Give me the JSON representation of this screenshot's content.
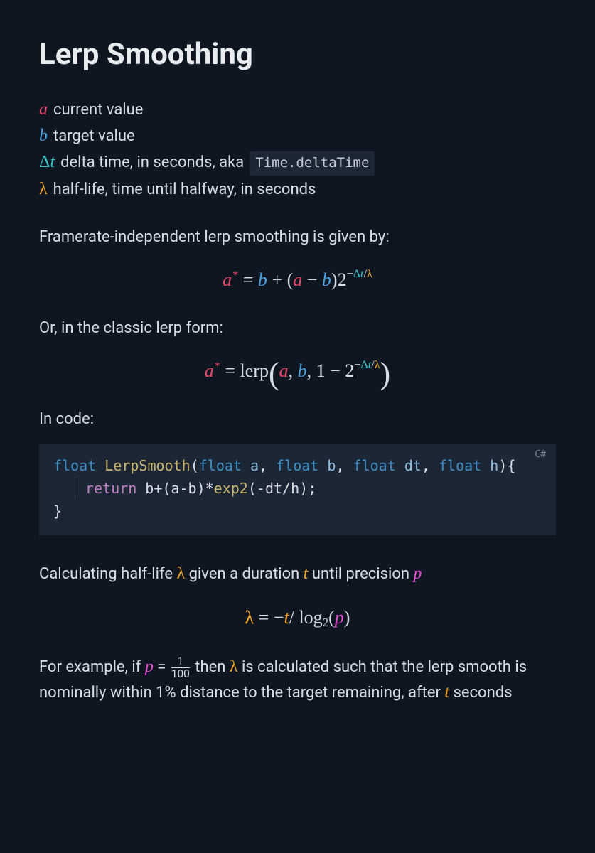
{
  "title": "Lerp Smoothing",
  "definitions": {
    "a": {
      "sym": "a",
      "desc": "current value"
    },
    "b": {
      "sym": "b",
      "desc": "target value"
    },
    "dt": {
      "sym_delta": "Δ",
      "sym_t": "t",
      "desc_pre": "delta time, in seconds, aka",
      "code": "Time.deltaTime"
    },
    "lambda": {
      "sym": "λ",
      "desc": "half-life, time until halfway, in seconds"
    }
  },
  "text": {
    "framerate_intro": "Framerate-independent lerp smoothing is given by:",
    "classic_intro": "Or, in the classic lerp form:",
    "code_intro": "In code:",
    "halflife_intro_pre": "Calculating half-life ",
    "halflife_intro_mid1": " given a duration ",
    "halflife_intro_mid2": " until precision ",
    "example_pre": "For example, if ",
    "example_mid1": "  then ",
    "example_mid2": " is calculated such that the lerp smooth is nominally within 1% distance to the target remaining, after ",
    "example_end": " seconds"
  },
  "equation1": {
    "astar": "a",
    "star": "*",
    "eq": " = ",
    "b": "b",
    "plus": " + (",
    "a": "a",
    "minus": " − ",
    "b2": "b",
    "close": ")2",
    "exp_minus": "−",
    "exp_dt_d": "Δ",
    "exp_dt_t": "t",
    "exp_slash": "/",
    "exp_lambda": "λ"
  },
  "equation2": {
    "astar": "a",
    "star": "*",
    "eq": " = ",
    "lerp": "lerp",
    "open": "(",
    "a": "a",
    "c1": ",  ",
    "b": "b",
    "c2": ",  ",
    "one_minus": "1 − 2",
    "exp_minus": "−",
    "exp_dt_d": "Δ",
    "exp_dt_t": "t",
    "exp_slash": "/",
    "exp_lambda": "λ",
    "close": ")"
  },
  "equation3": {
    "lambda": "λ",
    "eq": " = −",
    "t": "t",
    "slash": "/ ",
    "log": "log",
    "sub": "2",
    "open": "(",
    "p": "p",
    "close": ")"
  },
  "equation_inline_frac": {
    "p": "p",
    "eq": " = ",
    "num": "1",
    "den": "100"
  },
  "code": {
    "lang": "C#",
    "type": "float",
    "fn": "LerpSmooth",
    "open": "(",
    "p1t": "float",
    "p1n": "a",
    "c1": ", ",
    "p2t": "float",
    "p2n": "b",
    "c2": ", ",
    "p3t": "float",
    "p3n": "dt",
    "c3": ", ",
    "p4t": "float",
    "p4n": "h",
    "close_sig": "){",
    "ret": "return",
    "body_b": "b",
    "body_op1": "+(",
    "body_a": "a",
    "body_op2": "-",
    "body_b2": "b",
    "body_op3": ")*",
    "body_exp": "exp2",
    "body_op4": "(-",
    "body_dt": "dt",
    "body_op5": "/",
    "body_h": "h",
    "body_op6": ");",
    "close_fn": "}"
  }
}
